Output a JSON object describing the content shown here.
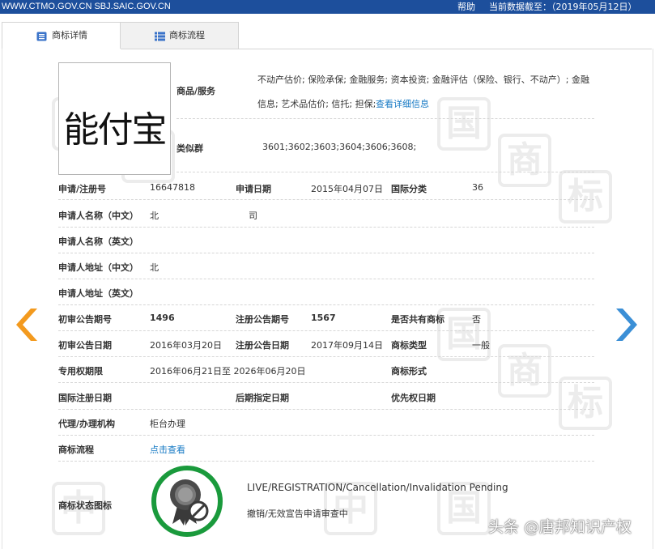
{
  "topbar": {
    "site": "WWW.CTMO.GOV.CN SBJ.SAIC.GOV.CN",
    "help": "帮助",
    "date_text": "当前数据截至：（2019年05月12日）"
  },
  "tabs": [
    {
      "label": "商标详情",
      "active": true
    },
    {
      "label": "商标流程",
      "active": false
    }
  ],
  "trademark_image_text": "能付宝",
  "goods": {
    "label": "商品/服务",
    "line1": "不动产估价; 保险承保; 金融服务; 资本投资; 金融评估（保险、银行、不动产）; 金融",
    "line2": "信息; 艺术品估价; 信托; 担保;",
    "link": "查看详细信息"
  },
  "similar_group": {
    "label": "类似群",
    "value": "3601;3602;3603;3604;3606;3608;"
  },
  "rows": {
    "reg_no_label": "申请/注册号",
    "reg_no": "16647818",
    "app_date_label": "申请日期",
    "app_date": "2015年04月07日",
    "intl_class_label": "国际分类",
    "intl_class": "36",
    "applicant_cn_label": "申请人名称（中文）",
    "applicant_cn_a": "北",
    "applicant_cn_b": "司",
    "applicant_en_label": "申请人名称（英文）",
    "addr_cn_label": "申请人地址（中文）",
    "addr_cn": "北",
    "addr_en_label": "申请人地址（英文）",
    "prelim_no_label": "初审公告期号",
    "prelim_no": "1496",
    "reg_notice_no_label": "注册公告期号",
    "reg_notice_no": "1567",
    "shared_label": "是否共有商标",
    "shared": "否",
    "prelim_date_label": "初审公告日期",
    "prelim_date": "2016年03月20日",
    "reg_notice_date_label": "注册公告日期",
    "reg_notice_date": "2017年09月14日",
    "tm_type_label": "商标类型",
    "tm_type": "一般",
    "exclusive_label": "专用权期限",
    "exclusive": "2016年06月21日至 2026年06月20日",
    "tm_form_label": "商标形式",
    "intl_reg_date_label": "国际注册日期",
    "later_date_label": "后期指定日期",
    "priority_label": "优先权日期",
    "agent_label": "代理/办理机构",
    "agent": "柜台办理",
    "flow_label": "商标流程",
    "flow_link": "点击查看",
    "status_icon_label": "商标状态图标",
    "status_en": "LIVE/REGISTRATION/Cancellation/Invalidation Pending",
    "status_cn": "撤销/无效宣告申请审查中"
  },
  "footer_watermark": "头条 @唐邦知识产权",
  "colors": {
    "topbar": "#1d4f9c",
    "link": "#1679c4",
    "arrow_left": "#f39a1e",
    "arrow_right": "#3b8fd6",
    "status_ring": "#1a9a3c"
  }
}
